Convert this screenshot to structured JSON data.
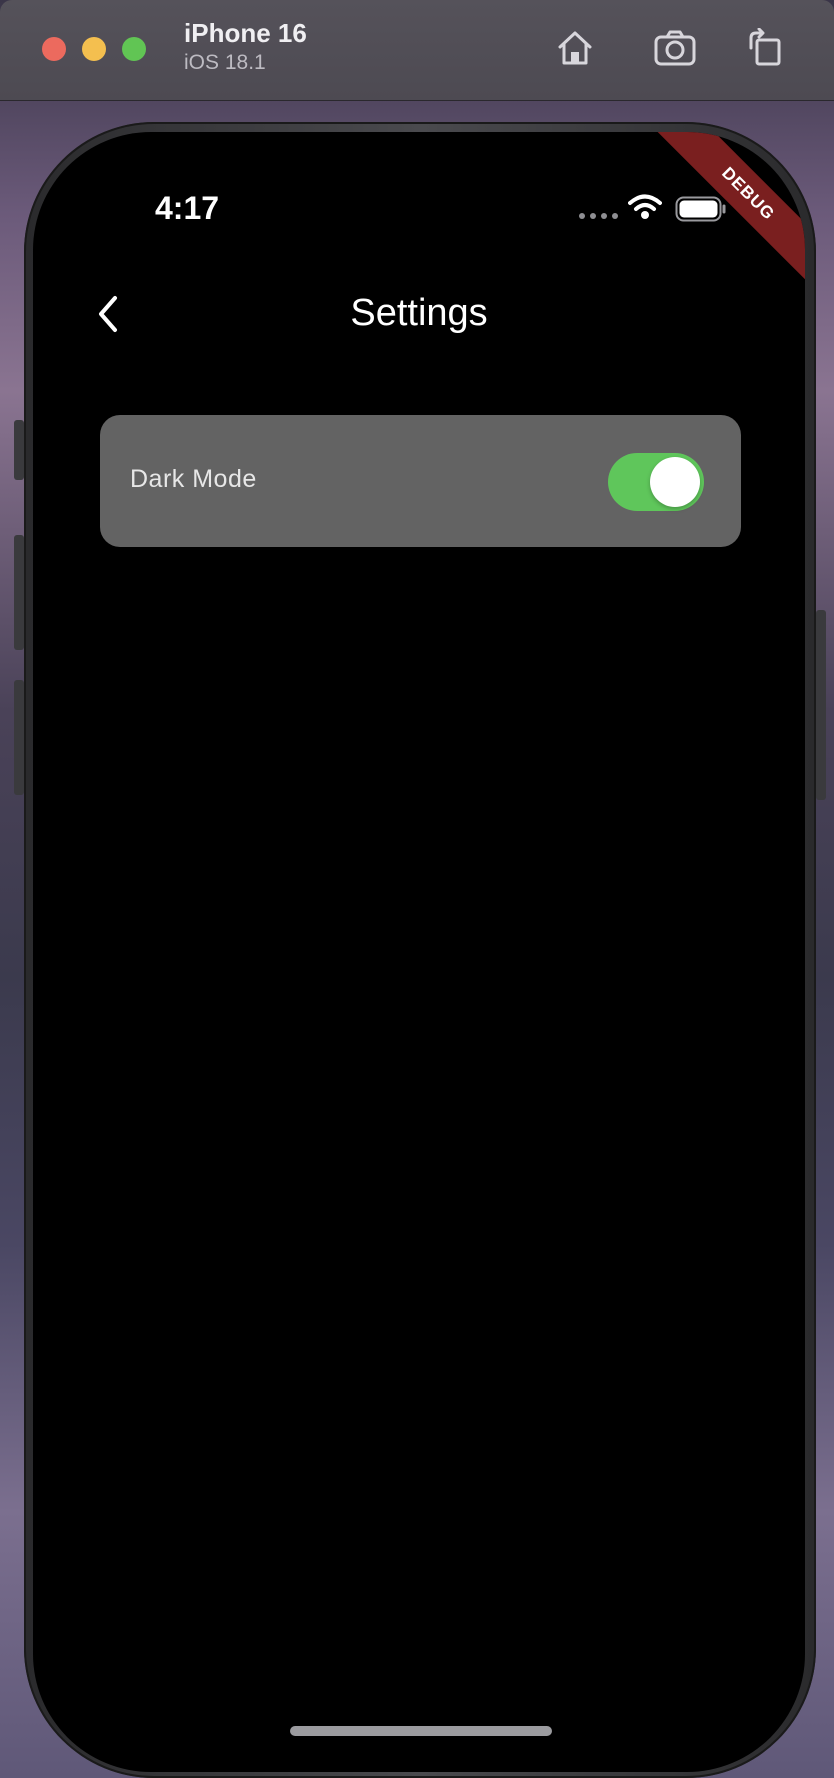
{
  "window": {
    "device_name": "iPhone 16",
    "os_version": "iOS 18.1",
    "buttons": {
      "home": "home-icon",
      "screenshot": "camera-icon",
      "rotate": "rotate-icon"
    }
  },
  "status_bar": {
    "time": "4:17",
    "icons": [
      "cellular-dots-icon",
      "wifi-icon",
      "battery-icon"
    ]
  },
  "debug_banner": "DEBUG",
  "nav": {
    "title": "Settings",
    "back_icon": "chevron-left-icon"
  },
  "settings": {
    "items": [
      {
        "label": "Dark Mode",
        "control": "toggle",
        "value": true
      }
    ]
  },
  "colors": {
    "toggle_on": "#5fc65b",
    "card_bg": "#636363",
    "screen_bg": "#000000",
    "debug_ribbon": "#7a1f1f"
  }
}
